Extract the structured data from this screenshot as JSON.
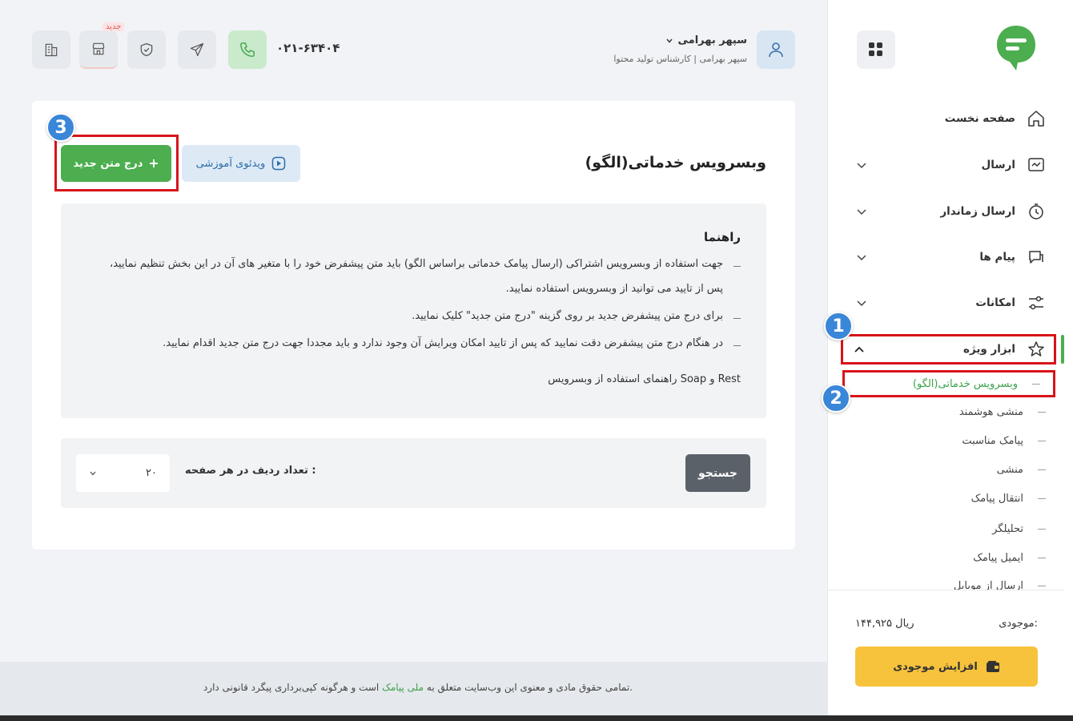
{
  "header": {
    "user_name": "سپهر بهرامی",
    "user_role": "سپهر بهرامی | کارشناس تولید محتوا",
    "phone": "۰۲۱-۶۳۴۰۴",
    "new_tag": "جدید",
    "icons": [
      "user-icon",
      "phone-icon",
      "send-icon",
      "shield-check-icon",
      "store-icon",
      "building-icon"
    ]
  },
  "sidebar": {
    "items": [
      {
        "label": "صفحه نخست",
        "icon": "home-icon"
      },
      {
        "label": "ارسال",
        "icon": "send-sms-icon"
      },
      {
        "label": "ارسال زماندار",
        "icon": "timer-icon"
      },
      {
        "label": "پیام ها",
        "icon": "chat-icon"
      },
      {
        "label": "امکانات",
        "icon": "sliders-icon"
      },
      {
        "label": "ابزار ویژه",
        "icon": "star-icon"
      }
    ],
    "sub_items": [
      {
        "label": "وبسرویس خدماتی(الگو)"
      },
      {
        "label": "منشی هوشمند"
      },
      {
        "label": "پیامک مناسبت"
      },
      {
        "label": "منشی"
      },
      {
        "label": "انتقال پیامک"
      },
      {
        "label": "تحلیلگر"
      },
      {
        "label": "ایمیل پیامک"
      },
      {
        "label": "ارسال از موبایل"
      }
    ],
    "balance_label": "موجودی:",
    "balance_value": "۱۴۴,۹۲۵ ریال",
    "topup_label": "افزایش موجودی"
  },
  "badges": {
    "one": "1",
    "two": "2",
    "three": "3"
  },
  "main": {
    "title": "وبسرویس خدماتی(الگو)",
    "video_button": "ویدئوی آموزشی",
    "new_text_button": "درج متن جدید",
    "guide": {
      "title": "راهنما",
      "lines": [
        "جهت استفاده از وبسرویس اشتراکی (ارسال پیامک خدماتی براساس الگو) باید متن پیشفرض خود را با متغیر های آن در این بخش تنظیم نمایید،",
        "پس از تایید می توانید از وبسرویس استفاده نمایید.",
        "برای درج متن پیشفرض جدید بر روی گزینه \"درج متن جدید\" کلیک نمایید.",
        "در هنگام درج متن پیشفرض دقت نمایید که پس از تایید امکان ویرایش آن وجود ندارد و باید مجددا جهت درج متن جدید اقدام نمایید."
      ],
      "link": "راهنمای استفاده از وبسرویس Soap و Rest"
    },
    "search_button": "جستجو",
    "rows_label": "تعداد ردیف در هر صفحه :",
    "rows_value": "۲۰"
  },
  "footer": {
    "text_before": "تمامی حقوق مادی و معنوی این وب‌سایت متعلق به",
    "brand": "ملی پیامک",
    "text_after": "است و هرگونه کپی‌برداری پیگرد قانونی دارد."
  },
  "colors": {
    "accent_green": "#4cae4f",
    "highlight_red": "#d7141a",
    "badge_blue": "#3a86d8",
    "topup_yellow": "#f7c33c"
  }
}
